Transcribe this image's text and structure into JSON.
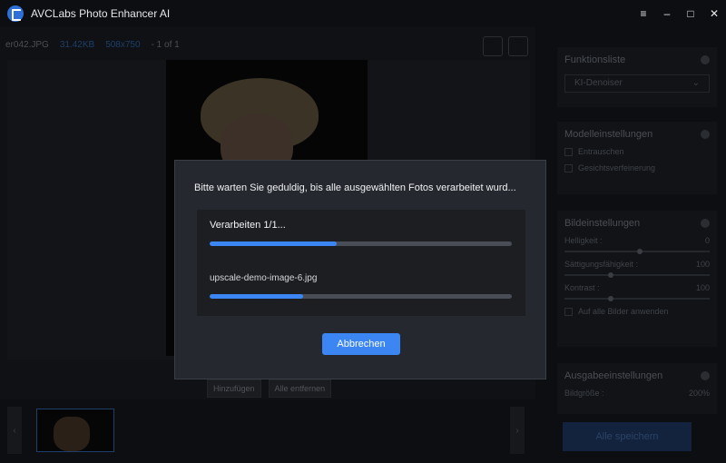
{
  "app": {
    "title": "AVCLabs Photo Enhancer AI",
    "window_controls": [
      "≡",
      "–",
      "□",
      "✕"
    ]
  },
  "image_info": {
    "filename": "er042.JPG",
    "filesize": "31.42KB",
    "dimensions": "508x750",
    "page": "- 1 of 1"
  },
  "thumbnail_actions": {
    "add_label": "Hinzufügen",
    "remove_all_label": "Alle entfernen"
  },
  "sidebar": {
    "function_list": {
      "title": "Funktionsliste",
      "selected_model": "KI-Denoiser"
    },
    "model_settings": {
      "title": "Modelleinstellungen",
      "options": [
        {
          "label": "Entrauschen"
        },
        {
          "label": "Gesichtsverfeinerung"
        }
      ]
    },
    "image_settings": {
      "title": "Bildeinstellungen",
      "brightness_label": "Helligkeit :",
      "brightness_value": "0",
      "saturation_label": "Sättigungsfähigkeit :",
      "saturation_value": "100",
      "contrast_label": "Kontrast :",
      "contrast_value": "100",
      "apply_all_label": "Auf alle Bilder anwenden"
    },
    "output_settings": {
      "title": "Ausgabeeinstellungen",
      "size_label": "Bildgröße :",
      "size_value": "200%"
    },
    "save_all_label": "Alle speichern"
  },
  "modal": {
    "title": "Bitte warten Sie geduldig, bis alle ausgewählten Fotos verarbeitet wurd...",
    "processing_label": "Verarbeiten 1/1...",
    "overall_progress": 0.42,
    "file_name": "upscale-demo-image-6.jpg",
    "file_progress": 0.31,
    "cancel_label": "Abbrechen"
  },
  "colors": {
    "accent": "#3b86f2",
    "modal_bg": "#25282e",
    "panel_bg": "#1c1e22"
  }
}
